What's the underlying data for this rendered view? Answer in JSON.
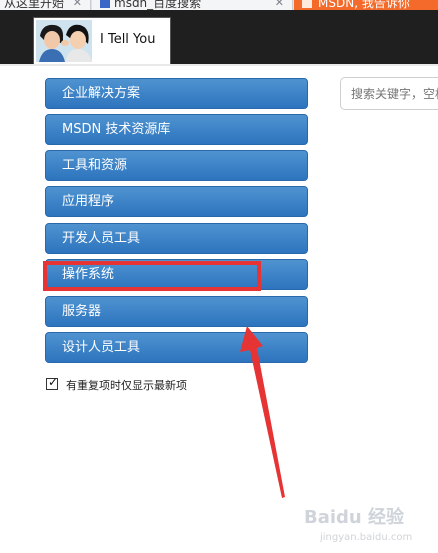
{
  "tabs": [
    {
      "label": "从这里开始",
      "favicon": ""
    },
    {
      "label": "msdn_百度搜索",
      "favicon": "baidu-paw-icon"
    },
    {
      "label": "MSDN, 我告诉你",
      "favicon": "msdn-icon"
    }
  ],
  "header": {
    "logo_text": "I Tell You"
  },
  "search": {
    "placeholder": "搜索关键字，空格分隔"
  },
  "menu": [
    {
      "label": "企业解决方案"
    },
    {
      "label": "MSDN 技术资源库"
    },
    {
      "label": "工具和资源"
    },
    {
      "label": "应用程序"
    },
    {
      "label": "开发人员工具"
    },
    {
      "label": "操作系统"
    },
    {
      "label": "服务器"
    },
    {
      "label": "设计人员工具"
    }
  ],
  "checkbox": {
    "label": "有重复项时仅显示最新项",
    "checked": true
  },
  "watermark": {
    "text": "Baidu 经验",
    "sub": "jingyan.baidu.com"
  },
  "colors": {
    "menu_button": "#3580c4",
    "header_bg": "#1f1f1f",
    "annotation": "#e63333",
    "active_tab": "#f36a2a"
  }
}
